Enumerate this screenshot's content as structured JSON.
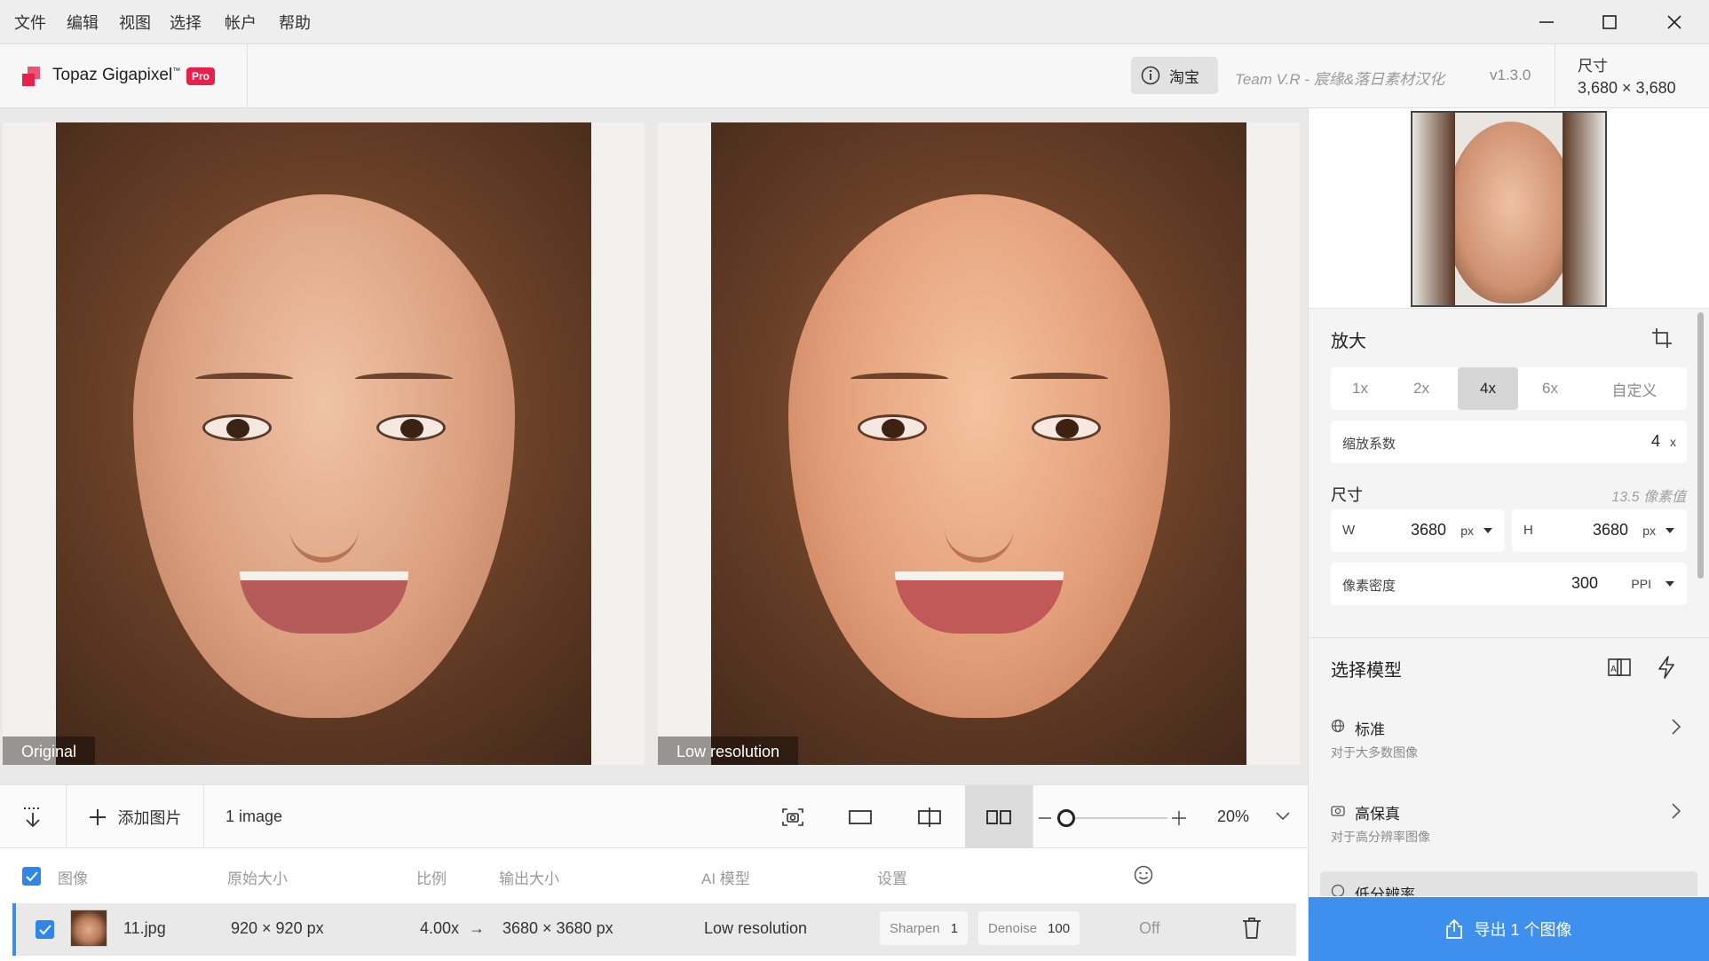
{
  "menubar": {
    "items": [
      "文件",
      "编辑",
      "视图",
      "选择",
      "帐户",
      "帮助"
    ]
  },
  "window_controls": {
    "minimize": "minimize-icon",
    "maximize": "maximize-icon",
    "close": "close-icon"
  },
  "header": {
    "app_name": "Topaz Gigapixel",
    "trademark": "™",
    "badge": "Pro",
    "info_button": "淘宝",
    "team_text": "Team V.R - 宸缘&落日素材汉化",
    "version": "v1.3.0",
    "size_label": "尺寸",
    "size_value": "3,680 × 3,680"
  },
  "viewer": {
    "left_label": "Original",
    "right_label": "Low resolution"
  },
  "toolbar": {
    "add_label": "添加图片",
    "count": "1 image",
    "zoom": "20%",
    "zoom_level": 0.2
  },
  "table": {
    "headers": {
      "image": "图像",
      "orig": "原始大小",
      "ratio": "比例",
      "out": "输出大小",
      "model": "AI 模型",
      "settings": "设置"
    },
    "row": {
      "file": "11.jpg",
      "orig": "920 × 920 px",
      "ratio": "4.00x",
      "arrow": "→",
      "out": "3680 × 3680 px",
      "model": "Low resolution",
      "sharpen_label": "Sharpen",
      "sharpen_value": "1",
      "denoise_label": "Denoise",
      "denoise_value": "100",
      "face": "Off"
    }
  },
  "panel": {
    "zoom_title": "放大",
    "scale_options": [
      "1x",
      "2x",
      "4x",
      "6x",
      "自定义"
    ],
    "scale_selected": "4x",
    "factor_label": "缩放系数",
    "factor_value": "4",
    "factor_unit": "x",
    "size_title": "尺寸",
    "size_hint": "13.5 像素值",
    "w_label": "W",
    "w_value": "3680",
    "h_label": "H",
    "h_value": "3680",
    "unit": "px",
    "density_label": "像素密度",
    "density_value": "300",
    "density_unit": "PPI",
    "model_title": "选择模型",
    "models": [
      {
        "name": "标准",
        "desc": "对于大多数图像"
      },
      {
        "name": "高保真",
        "desc": "对于高分辨率图像"
      },
      {
        "name": "低分辨率"
      }
    ],
    "export_label": "导出 1 个图像"
  },
  "colors": {
    "accent": "#3f8fee",
    "pro_badge": "#e8204b",
    "logo": "#e8204b"
  }
}
